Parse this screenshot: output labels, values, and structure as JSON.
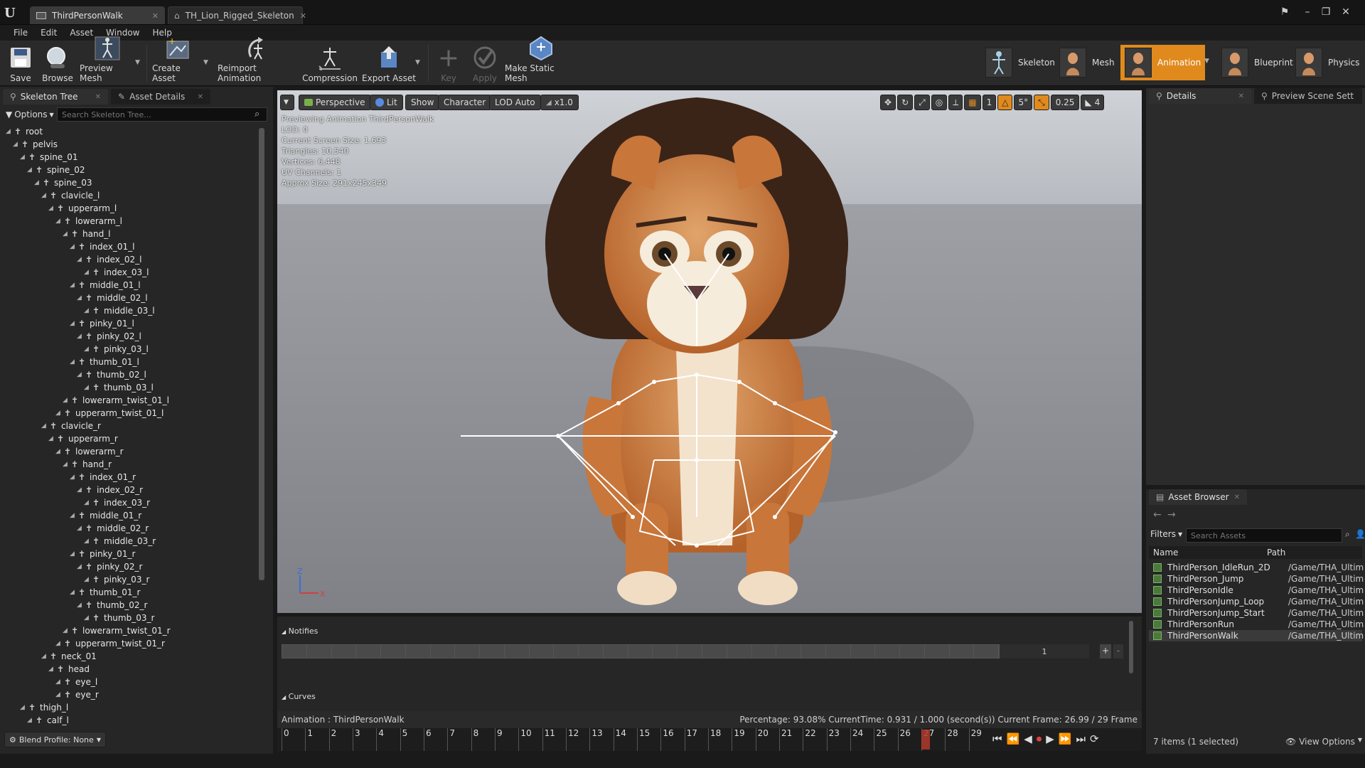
{
  "tabs": [
    {
      "label": "ThirdPersonWalk",
      "active": true
    },
    {
      "label": "TH_Lion_Rigged_Skeleton",
      "active": false
    }
  ],
  "menu": [
    "File",
    "Edit",
    "Asset",
    "Window",
    "Help"
  ],
  "toolbar": {
    "buttons": [
      {
        "label": "Save",
        "icon": "save-icon"
      },
      {
        "label": "Browse",
        "icon": "browse-icon"
      },
      {
        "label": "Preview Mesh",
        "icon": "preview-mesh-icon"
      },
      {
        "label": "Create Asset",
        "icon": "create-asset-icon"
      },
      {
        "label": "Reimport Animation",
        "icon": "reimport-icon"
      },
      {
        "label": "Compression",
        "icon": "compression-icon"
      },
      {
        "label": "Export Asset",
        "icon": "export-icon"
      },
      {
        "label": "Key",
        "icon": "plus-icon",
        "disabled": true
      },
      {
        "label": "Apply",
        "icon": "check-icon",
        "disabled": true
      },
      {
        "label": "Make Static Mesh",
        "icon": "static-mesh-icon"
      }
    ],
    "modes": [
      {
        "label": "Skeleton"
      },
      {
        "label": "Mesh"
      },
      {
        "label": "Animation",
        "active": true
      },
      {
        "label": "Blueprint"
      },
      {
        "label": "Physics"
      }
    ]
  },
  "left_panel": {
    "tabs": [
      "Skeleton Tree",
      "Asset Details"
    ],
    "options_label": "Options",
    "search_placeholder": "Search Skeleton Tree...",
    "bones": [
      {
        "name": "root",
        "depth": 0
      },
      {
        "name": "pelvis",
        "depth": 1
      },
      {
        "name": "spine_01",
        "depth": 2
      },
      {
        "name": "spine_02",
        "depth": 3
      },
      {
        "name": "spine_03",
        "depth": 4
      },
      {
        "name": "clavicle_l",
        "depth": 5
      },
      {
        "name": "upperarm_l",
        "depth": 6
      },
      {
        "name": "lowerarm_l",
        "depth": 7
      },
      {
        "name": "hand_l",
        "depth": 8
      },
      {
        "name": "index_01_l",
        "depth": 9
      },
      {
        "name": "index_02_l",
        "depth": 10
      },
      {
        "name": "index_03_l",
        "depth": 11
      },
      {
        "name": "middle_01_l",
        "depth": 9
      },
      {
        "name": "middle_02_l",
        "depth": 10
      },
      {
        "name": "middle_03_l",
        "depth": 11
      },
      {
        "name": "pinky_01_l",
        "depth": 9
      },
      {
        "name": "pinky_02_l",
        "depth": 10
      },
      {
        "name": "pinky_03_l",
        "depth": 11
      },
      {
        "name": "thumb_01_l",
        "depth": 9
      },
      {
        "name": "thumb_02_l",
        "depth": 10
      },
      {
        "name": "thumb_03_l",
        "depth": 11
      },
      {
        "name": "lowerarm_twist_01_l",
        "depth": 8
      },
      {
        "name": "upperarm_twist_01_l",
        "depth": 7
      },
      {
        "name": "clavicle_r",
        "depth": 5
      },
      {
        "name": "upperarm_r",
        "depth": 6
      },
      {
        "name": "lowerarm_r",
        "depth": 7
      },
      {
        "name": "hand_r",
        "depth": 8
      },
      {
        "name": "index_01_r",
        "depth": 9
      },
      {
        "name": "index_02_r",
        "depth": 10
      },
      {
        "name": "index_03_r",
        "depth": 11
      },
      {
        "name": "middle_01_r",
        "depth": 9
      },
      {
        "name": "middle_02_r",
        "depth": 10
      },
      {
        "name": "middle_03_r",
        "depth": 11
      },
      {
        "name": "pinky_01_r",
        "depth": 9
      },
      {
        "name": "pinky_02_r",
        "depth": 10
      },
      {
        "name": "pinky_03_r",
        "depth": 11
      },
      {
        "name": "thumb_01_r",
        "depth": 9
      },
      {
        "name": "thumb_02_r",
        "depth": 10
      },
      {
        "name": "thumb_03_r",
        "depth": 11
      },
      {
        "name": "lowerarm_twist_01_r",
        "depth": 8
      },
      {
        "name": "upperarm_twist_01_r",
        "depth": 7
      },
      {
        "name": "neck_01",
        "depth": 5
      },
      {
        "name": "head",
        "depth": 6
      },
      {
        "name": "eye_l",
        "depth": 7
      },
      {
        "name": "eye_r",
        "depth": 7
      },
      {
        "name": "thigh_l",
        "depth": 2
      },
      {
        "name": "calf_l",
        "depth": 3
      }
    ],
    "blend_profile": "Blend Profile: None"
  },
  "viewport": {
    "buttons": {
      "perspective": "Perspective",
      "lit": "Lit",
      "show": "Show",
      "character": "Character",
      "lod": "LOD Auto",
      "speed": "x1.0",
      "rotation_snap": "5°",
      "scale_snap": "0.25",
      "camera_speed": "4",
      "grid": "1"
    },
    "info_lines": [
      "Previewing Animation ThirdPersonWalk",
      "LOD: 0",
      "Current Screen Size: 1.693",
      "Triangles: 10,540",
      "Vertices: 6,448",
      "UV Channels: 1",
      "Approx Size: 291x245x349"
    ]
  },
  "notifies": {
    "label": "Notifies",
    "track_value": "1",
    "curves_label": "Curves"
  },
  "status": {
    "animation": "Animation :  ThirdPersonWalk",
    "stats": "Percentage:  93.08%  CurrentTime:  0.931 / 1.000 (second(s))  Current Frame:  26.99 / 29 Frame"
  },
  "timeline": {
    "frames": [
      "0",
      "1",
      "2",
      "3",
      "4",
      "5",
      "6",
      "7",
      "8",
      "9",
      "10",
      "11",
      "12",
      "13",
      "14",
      "15",
      "16",
      "17",
      "18",
      "19",
      "20",
      "21",
      "22",
      "23",
      "24",
      "25",
      "26",
      "27",
      "28",
      "29"
    ],
    "current_frame": 26.99,
    "total_frames": 29
  },
  "details_panel": {
    "tabs": [
      "Details",
      "Preview Scene Sett"
    ]
  },
  "asset_browser": {
    "tab": "Asset Browser",
    "filters_label": "Filters",
    "search_placeholder": "Search Assets",
    "columns": [
      "Name",
      "Path"
    ],
    "rows": [
      {
        "name": "ThirdPerson_IdleRun_2D",
        "path": "/Game/THA_Ultim"
      },
      {
        "name": "ThirdPerson_Jump",
        "path": "/Game/THA_Ultim"
      },
      {
        "name": "ThirdPersonIdle",
        "path": "/Game/THA_Ultim"
      },
      {
        "name": "ThirdPersonJump_Loop",
        "path": "/Game/THA_Ultim"
      },
      {
        "name": "ThirdPersonJump_Start",
        "path": "/Game/THA_Ultim"
      },
      {
        "name": "ThirdPersonRun",
        "path": "/Game/THA_Ultim"
      },
      {
        "name": "ThirdPersonWalk",
        "path": "/Game/THA_Ultim",
        "selected": true
      }
    ],
    "count": "7 items (1 selected)",
    "view_options": "View Options"
  },
  "colors": {
    "accent_orange": "#e08a1e",
    "bg_dark": "#1a1a1a",
    "panel": "#262626",
    "playhead": "#c0392b"
  }
}
